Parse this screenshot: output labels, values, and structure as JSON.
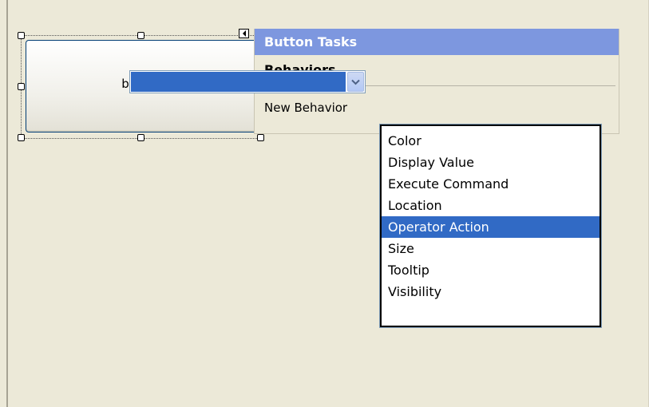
{
  "designer": {
    "button_text": "button"
  },
  "tasks_panel": {
    "title": "Button Tasks",
    "section_title": "Behaviors",
    "new_behavior_label": "New Behavior",
    "new_behavior_value": ""
  },
  "dropdown": {
    "items": [
      {
        "label": "Color",
        "selected": false
      },
      {
        "label": "Display Value",
        "selected": false
      },
      {
        "label": "Execute Command",
        "selected": false
      },
      {
        "label": "Location",
        "selected": false
      },
      {
        "label": "Operator Action",
        "selected": true
      },
      {
        "label": "Size",
        "selected": false
      },
      {
        "label": "Tooltip",
        "selected": false
      },
      {
        "label": "Visibility",
        "selected": false
      }
    ]
  },
  "colors": {
    "panel_header": "#7d97df",
    "selection": "#316ac5",
    "surface": "#ece9d8"
  },
  "icons": {
    "smart_tag": "smart-tag-collapse-icon",
    "combo_arrow": "chevron-down-icon"
  }
}
